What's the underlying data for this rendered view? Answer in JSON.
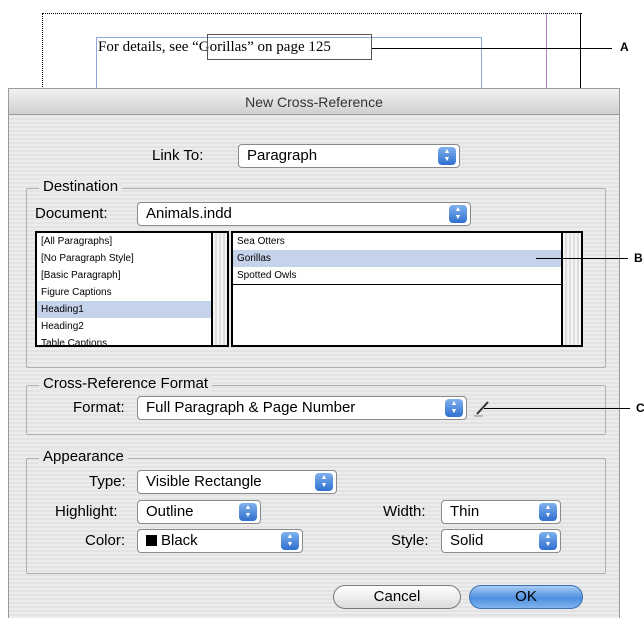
{
  "document": {
    "text": "For details, see “Gorillas” on page 125",
    "callout_a": "A",
    "callout_b": "B",
    "callout_c": "C"
  },
  "dialog": {
    "title": "New Cross-Reference",
    "link_to": {
      "label": "Link To:",
      "value": "Paragraph"
    },
    "destination": {
      "legend": "Destination",
      "document_label": "Document:",
      "document_value": "Animals.indd",
      "styles": [
        "[All Paragraphs]",
        "[No Paragraph Style]",
        "[Basic Paragraph]",
        "Figure Captions",
        "Heading1",
        "Heading2",
        "Table Captions"
      ],
      "selected_style": "Heading1",
      "paragraphs": [
        "Sea Otters",
        "Gorillas",
        "Spotted Owls"
      ],
      "selected_paragraph": "Gorillas"
    },
    "format_group": {
      "legend": "Cross-Reference Format",
      "format_label": "Format:",
      "format_value": "Full Paragraph & Page Number"
    },
    "appearance": {
      "legend": "Appearance",
      "type_label": "Type:",
      "type_value": "Visible Rectangle",
      "highlight_label": "Highlight:",
      "highlight_value": "Outline",
      "width_label": "Width:",
      "width_value": "Thin",
      "color_label": "Color:",
      "color_value": "Black",
      "style_label": "Style:",
      "style_value": "Solid"
    },
    "buttons": {
      "cancel": "Cancel",
      "ok": "OK"
    }
  },
  "colors": {
    "selection": "#c5d3ea",
    "default_button": "#4d8fe0"
  }
}
